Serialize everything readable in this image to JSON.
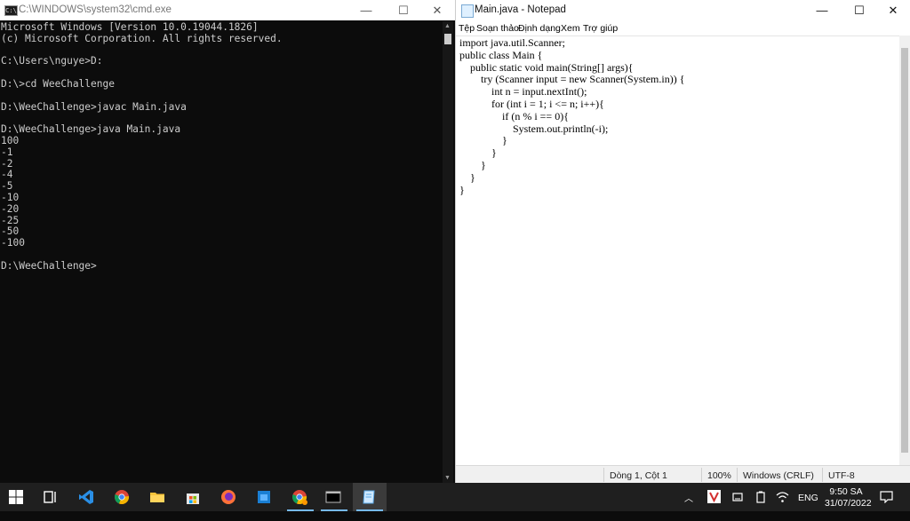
{
  "cmd": {
    "title": "C:\\WINDOWS\\system32\\cmd.exe",
    "icon": "C:\\",
    "lines": [
      "Microsoft Windows [Version 10.0.19044.1826]",
      "(c) Microsoft Corporation. All rights reserved.",
      "",
      "C:\\Users\\nguye>D:",
      "",
      "D:\\>cd WeeChallenge",
      "",
      "D:\\WeeChallenge>javac Main.java",
      "",
      "D:\\WeeChallenge>java Main.java",
      "100",
      "-1",
      "-2",
      "-4",
      "-5",
      "-10",
      "-20",
      "-25",
      "-50",
      "-100",
      "",
      "D:\\WeeChallenge>"
    ]
  },
  "notepad": {
    "title": "Main.java - Notepad",
    "menu": [
      "Tệp",
      "Soạn thảo",
      "Định dạng",
      "Xem",
      "Trợ giúp"
    ],
    "code": [
      "import java.util.Scanner;",
      "public class Main {",
      "    public static void main(String[] args){",
      "        try (Scanner input = new Scanner(System.in)) {",
      "            int n = input.nextInt();",
      "            for (int i = 1; i <= n; i++){",
      "                if (n % i == 0){",
      "                    System.out.println(-i);",
      "                }",
      "            }",
      "        }",
      "    }",
      "}"
    ],
    "status": {
      "position": "Dòng 1, Cột 1",
      "zoom": "100%",
      "line_ending": "Windows (CRLF)",
      "encoding": "UTF-8"
    }
  },
  "window_controls": {
    "minimize": "—",
    "maximize": "☐",
    "close": "✕"
  },
  "taskbar": {
    "language": "ENG",
    "time": "9:50 SA",
    "date": "31/07/2022",
    "apps": [
      "windows-start",
      "task-view",
      "vscode",
      "chrome",
      "file-explorer",
      "microsoft-store",
      "firefox",
      "blue-app",
      "chrome-profile",
      "cmd",
      "notepad"
    ]
  },
  "colors": {
    "cmd_bg": "#0c0c0c",
    "cmd_text": "#cccccc",
    "taskbar_bg": "#1f1f1f",
    "accent": "#76b9ed"
  }
}
